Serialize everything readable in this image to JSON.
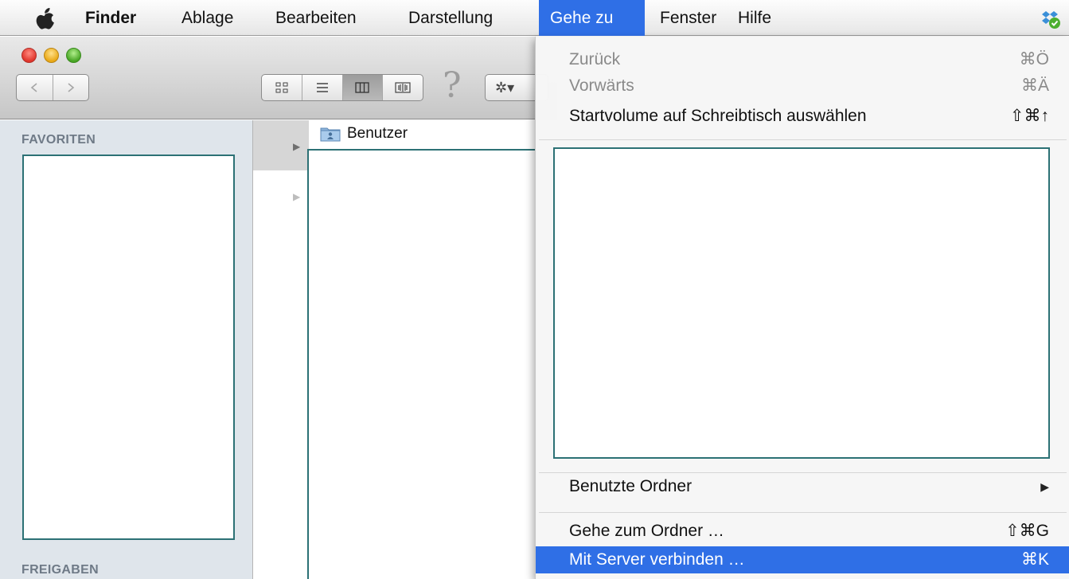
{
  "menubar": {
    "app_name": "Finder",
    "items": [
      "Ablage",
      "Bearbeiten",
      "Darstellung",
      "Gehe zu",
      "Fenster",
      "Hilfe"
    ],
    "active_item": "Gehe zu",
    "apple_icon": "apple-logo",
    "status_icon": "sync-check-icon"
  },
  "window": {
    "toolbar": {
      "nav_back_icon": "chevron-left",
      "nav_forward_icon": "chevron-right",
      "view_modes": [
        "icon-view",
        "list-view",
        "column-view",
        "coverflow-view"
      ],
      "selected_view": "column-view",
      "help_glyph": "?",
      "action_glyph": "✲▾"
    },
    "sidebar": {
      "favorites_heading": "FAVORITEN",
      "shared_heading": "FREIGABEN"
    },
    "column": {
      "folder_name": "Benutzer"
    }
  },
  "dropdown": {
    "back": {
      "label": "Zurück",
      "shortcut": "⌘Ö"
    },
    "forward": {
      "label": "Vorwärts",
      "shortcut": "⌘Ä"
    },
    "startup": {
      "label": "Startvolume auf Schreibtisch auswählen",
      "shortcut": "⇧⌘↑"
    },
    "recent": {
      "label": "Benutzte Ordner",
      "submenu_glyph": "▶"
    },
    "goto_folder": {
      "label": "Gehe zum Ordner …",
      "shortcut": "⇧⌘G"
    },
    "connect_server": {
      "label": "Mit Server verbinden …",
      "shortcut": "⌘K"
    }
  },
  "colors": {
    "highlight": "#2f6fe6",
    "placeholder_border": "#2c7175"
  }
}
